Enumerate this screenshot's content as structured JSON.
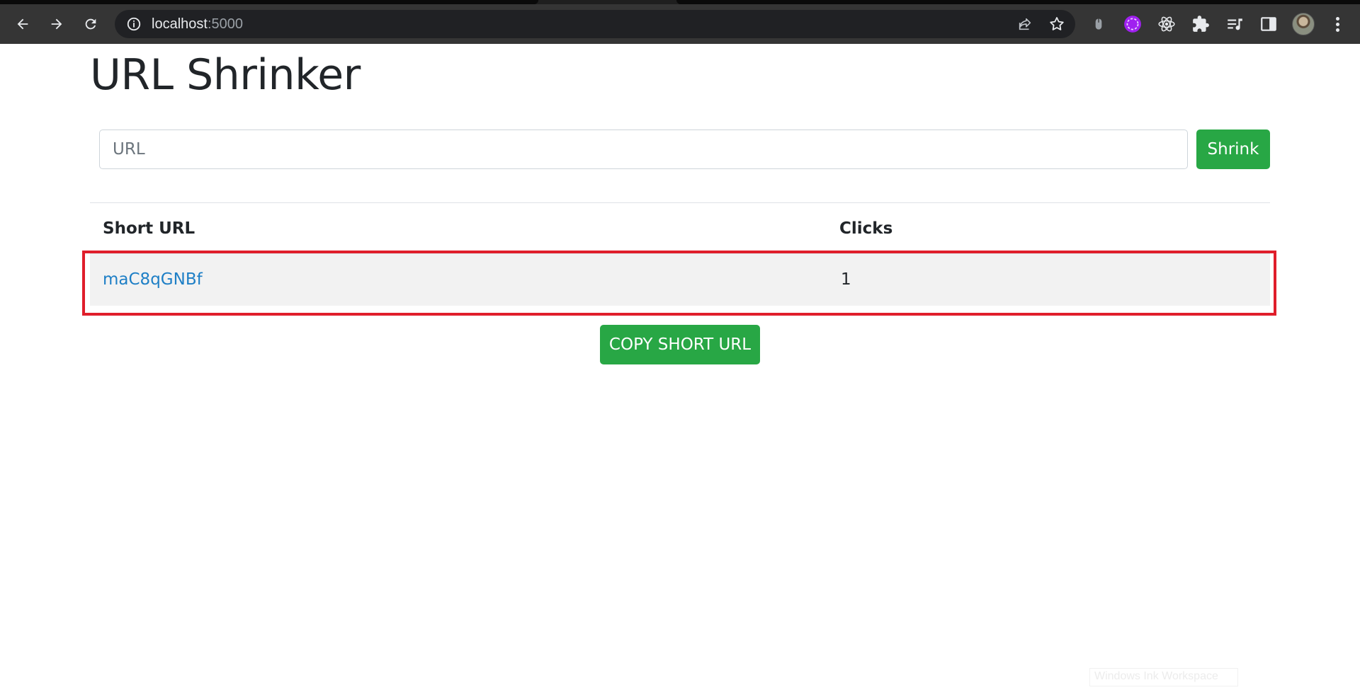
{
  "browser": {
    "url_host": "localhost",
    "url_port": ":5000",
    "extensions": [
      "mouse-icon",
      "purple-extension-icon",
      "react-icon",
      "puzzle-icon",
      "media-queue-icon",
      "sidepanel-icon"
    ]
  },
  "page": {
    "title": "URL Shrinker",
    "form": {
      "url_placeholder": "URL",
      "url_value": "",
      "submit_label": "Shrink"
    },
    "table": {
      "headers": [
        "Short URL",
        "Clicks"
      ],
      "rows": [
        {
          "short_url": "maC8qGNBf",
          "clicks": "1"
        }
      ]
    },
    "copy_button_label": "COPY SHORT URL",
    "highlight_color": "#e01e2b",
    "accent_color": "#28a745",
    "watermark_text": "Windows Ink Workspace"
  }
}
